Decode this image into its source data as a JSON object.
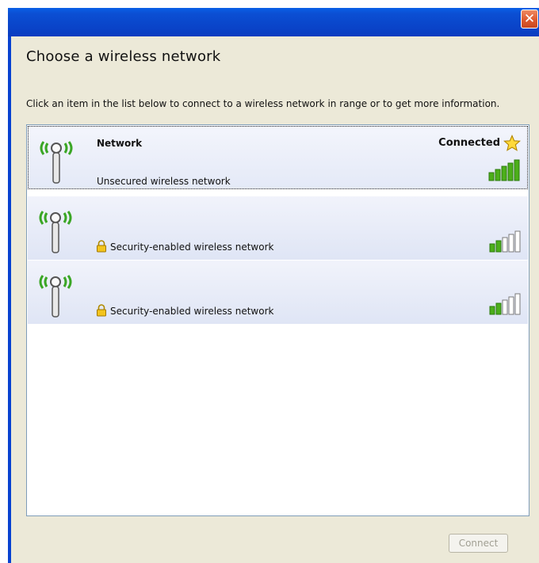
{
  "window": {
    "close_glyph": "✕"
  },
  "dialog": {
    "heading": "Choose a wireless network",
    "instruction": "Click an item in the list below to connect to a wireless network in range or to get more information."
  },
  "networks": [
    {
      "name": "Network",
      "status": "Connected",
      "description": "Unsecured wireless network",
      "secured": false,
      "selected": true,
      "signal_bars": 5
    },
    {
      "name": "",
      "status": "",
      "description": "Security-enabled wireless network",
      "secured": true,
      "selected": false,
      "signal_bars": 2
    },
    {
      "name": "",
      "status": "",
      "description": "Security-enabled wireless network",
      "secured": true,
      "selected": false,
      "signal_bars": 2
    }
  ],
  "footer": {
    "connect_label": "Connect"
  },
  "icons": {
    "antenna": "wireless-antenna-icon",
    "star": "star-icon",
    "lock": "lock-icon",
    "signal": "signal-strength-icon"
  },
  "colors": {
    "titlebar": "#0a43c8",
    "dialog_bg": "#ece9d8",
    "item_bg": "#dfe5f5",
    "signal_green": "#4caf1a",
    "antenna_waves": "#3aa625"
  }
}
